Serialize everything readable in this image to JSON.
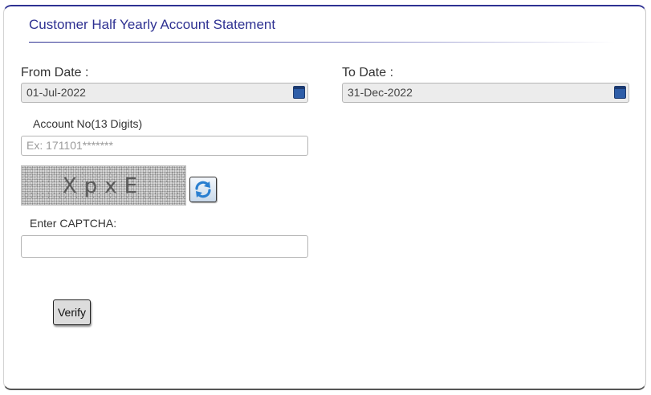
{
  "header": {
    "title": "Customer Half Yearly Account Statement"
  },
  "form": {
    "from_date": {
      "label": "From Date :",
      "value": "01-Jul-2022",
      "icon": "calendar-icon"
    },
    "to_date": {
      "label": "To Date :",
      "value": "31-Dec-2022",
      "icon": "calendar-icon"
    },
    "account_no": {
      "label": "Account No(13 Digits)",
      "value": "",
      "placeholder": "Ex: 171101*******"
    },
    "captcha": {
      "image_text": "XpxE",
      "refresh_icon": "refresh-icon",
      "label": "Enter CAPTCHA:",
      "value": ""
    },
    "verify_label": "Verify"
  },
  "colors": {
    "title": "#2e3192",
    "panel_top_border": "#2e3192",
    "calendar_icon": "#2f5ea8",
    "date_field_bg": "#ececec"
  }
}
